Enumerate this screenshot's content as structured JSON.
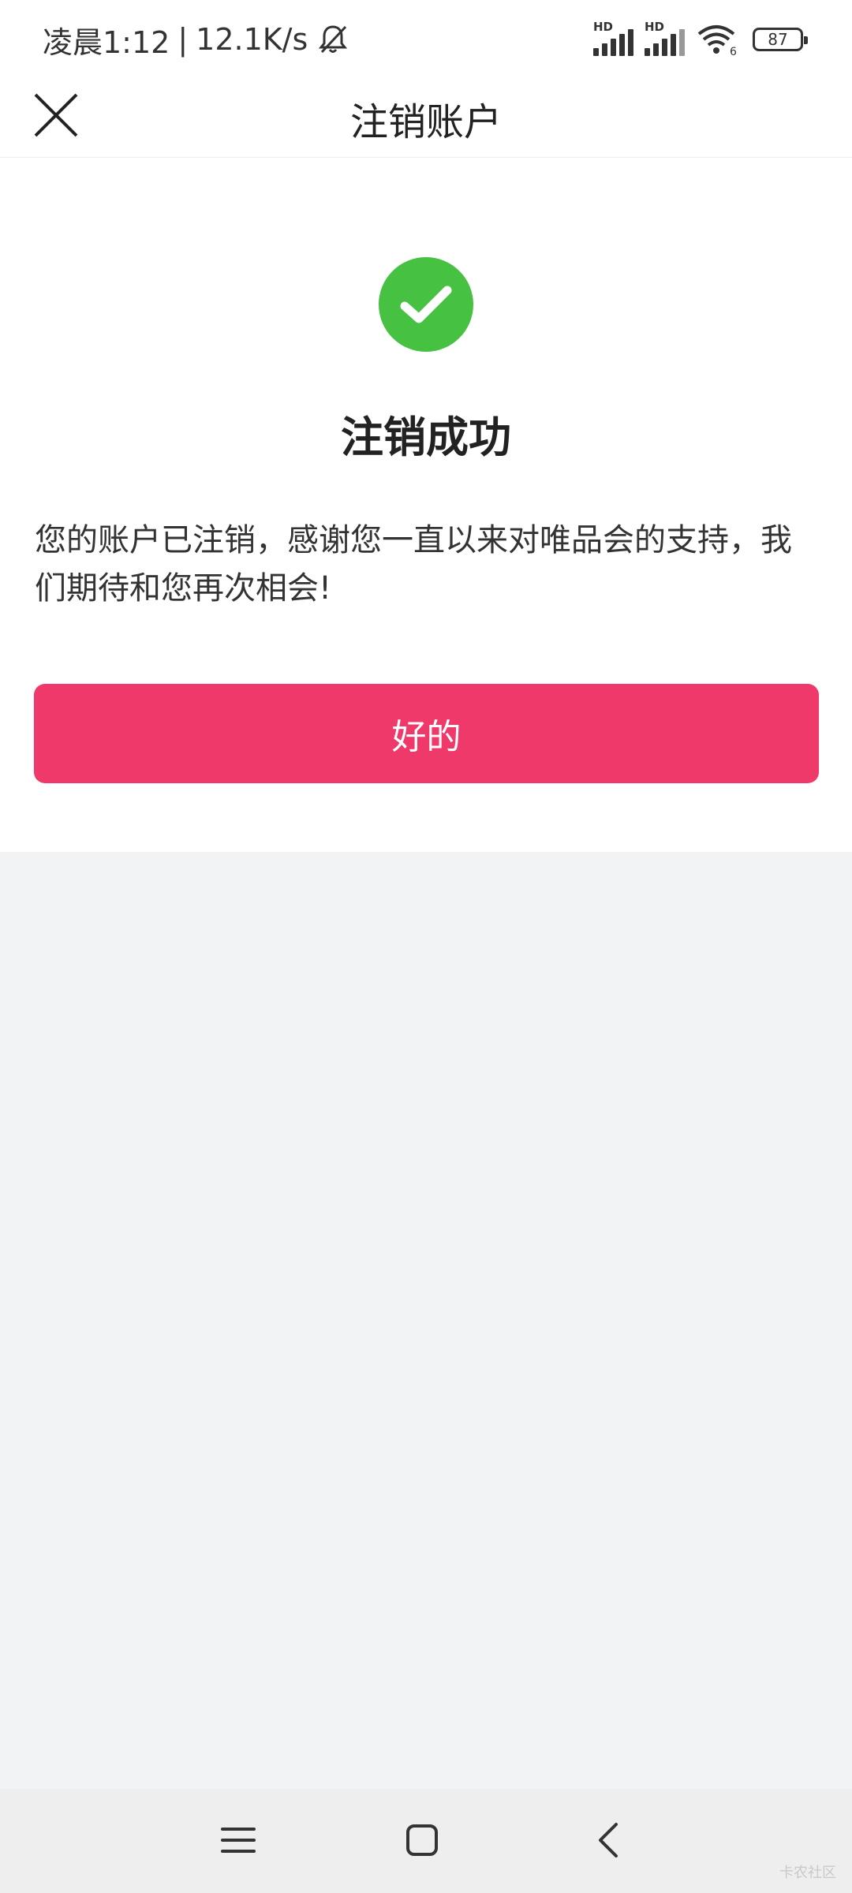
{
  "status_bar": {
    "time": "凌晨1:12",
    "separator": "|",
    "speed": "12.1K/s",
    "sim1_label": "HD",
    "sim2_label": "HD",
    "wifi_label": "6",
    "battery": "87"
  },
  "nav": {
    "title": "注销账户"
  },
  "result": {
    "title": "注销成功",
    "message": "您的账户已注销，感谢您一直以来对唯品会的支持，我们期待和您再次相会!",
    "button_label": "好的"
  },
  "colors": {
    "success": "#46c142",
    "primary_button": "#ef396a",
    "page_background": "#f2f3f5"
  },
  "icons": {
    "close": "close-icon",
    "success": "check-circle-icon",
    "menu": "menu-icon",
    "home": "home-icon",
    "back": "back-icon"
  },
  "watermark": "卡农社区"
}
